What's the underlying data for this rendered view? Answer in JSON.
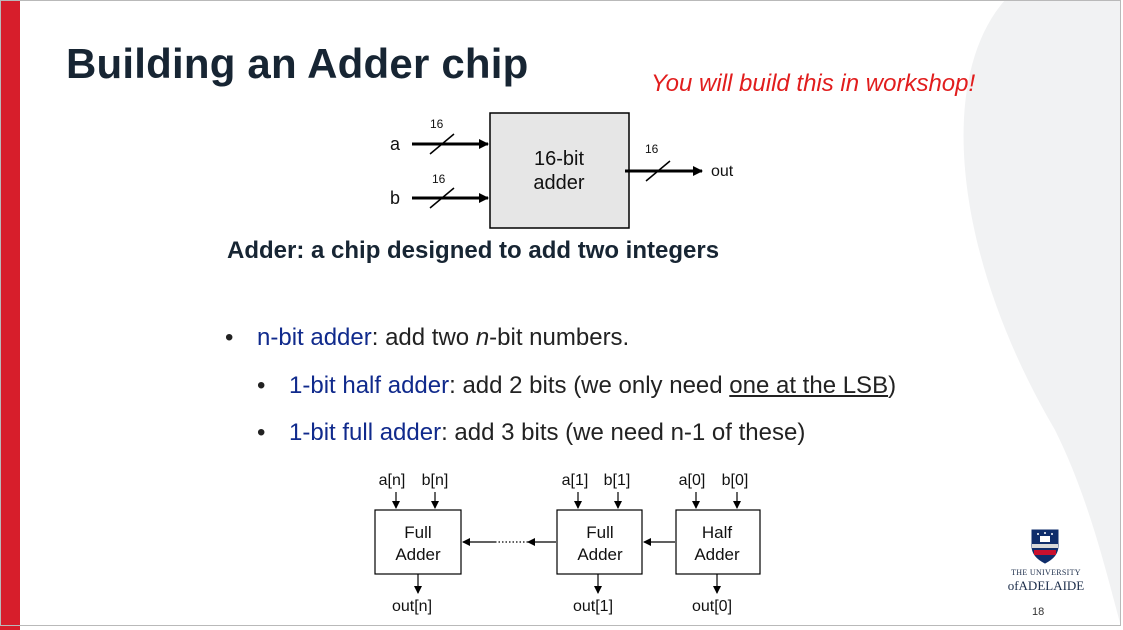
{
  "title": "Building an Adder chip",
  "note": "You will build this in workshop!",
  "top_diagram": {
    "input_a": "a",
    "input_b": "b",
    "width_a": "16",
    "width_b": "16",
    "width_out": "16",
    "output": "out",
    "box_line1": "16-bit",
    "box_line2": "adder"
  },
  "subtitle": "Adder: a chip designed to add two integers",
  "bullets": {
    "b1": {
      "dot": "•",
      "term": "n-bit adder",
      "text_a": ": add two ",
      "italic": "n",
      "text_b": "-bit numbers."
    },
    "b2": {
      "dot": "•",
      "term": "1-bit half adder",
      "text_a": ": add 2 bits (we only need ",
      "underline": "one at the LSB",
      "text_b": ")"
    },
    "b3": {
      "dot": "•",
      "term": "1-bit full adder",
      "text_a": ": add 3 bits (we need n-1 of these)"
    }
  },
  "chain": {
    "blocks": [
      {
        "in_a": "a[n]",
        "in_b": "b[n]",
        "line1": "Full",
        "line2": "Adder",
        "out": "out[n]"
      },
      {
        "in_a": "a[1]",
        "in_b": "b[1]",
        "line1": "Full",
        "line2": "Adder",
        "out": "out[1]"
      },
      {
        "in_a": "a[0]",
        "in_b": "b[0]",
        "line1": "Half",
        "line2": "Adder",
        "out": "out[0]"
      }
    ]
  },
  "logo": {
    "line1": "THE UNIVERSITY",
    "line2": "ofADELAIDE"
  },
  "page_number": "18",
  "colors": {
    "accent_red": "#d71e2b",
    "note_red": "#e11d1d",
    "term_blue": "#102a8c",
    "title_navy": "#172533"
  }
}
